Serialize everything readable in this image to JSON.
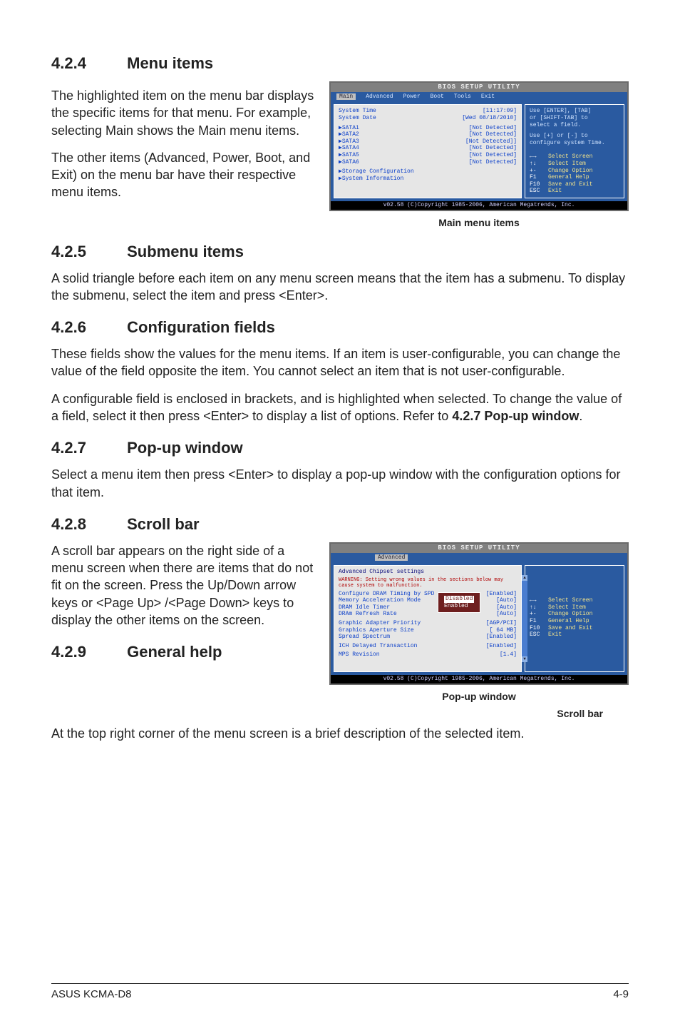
{
  "sections": {
    "s424": {
      "num": "4.2.4",
      "title": "Menu items"
    },
    "s425": {
      "num": "4.2.5",
      "title": "Submenu items"
    },
    "s426": {
      "num": "4.2.6",
      "title": "Configuration fields"
    },
    "s427": {
      "num": "4.2.7",
      "title": "Pop-up window"
    },
    "s428": {
      "num": "4.2.8",
      "title": "Scroll bar"
    },
    "s429": {
      "num": "4.2.9",
      "title": "General help"
    }
  },
  "para": {
    "p424a": "The highlighted item on the menu bar displays the specific items for that menu. For example, selecting Main shows the Main menu items.",
    "p424b": "The other items (Advanced, Power, Boot, and Exit) on the menu bar have their respective menu items.",
    "p425": "A solid triangle before each item on any menu screen means that the item has a submenu. To display the submenu, select the item and press <Enter>.",
    "p426a": "These fields show the values for the menu items. If an item is user-configurable, you can change the value of the field opposite the item. You cannot select an item that is not user-configurable.",
    "p426b_pre": "A configurable field is enclosed in brackets, and is highlighted when selected. To change the value of a field, select it then press <Enter> to display a list of options. Refer to ",
    "p426b_ref": "4.2.7 Pop-up window",
    "p426b_post": ".",
    "p427": "Select a menu item then press <Enter> to display a pop-up window with the configuration options for that item.",
    "p428": "A scroll bar appears on the right side of a menu screen when there are items that do not fit on the screen. Press the Up/Down arrow keys or <Page Up> /<Page Down> keys to display the other items on the screen.",
    "p429": "At the top right corner of the menu screen is a brief description of the selected item."
  },
  "captions": {
    "fig1": "Main menu items",
    "fig2a": "Pop-up window",
    "fig2b": "Scroll bar"
  },
  "bios1": {
    "title": "BIOS SETUP UTILITY",
    "menus": [
      "Main",
      "Advanced",
      "Power",
      "Boot",
      "Tools",
      "Exit"
    ],
    "active_menu": "Main",
    "items": [
      {
        "label": "System Time",
        "value": "[11:17:09]"
      },
      {
        "label": "System Date",
        "value": "[Wed 08/18/2010]"
      }
    ],
    "sata": [
      {
        "label": "SATA1",
        "value": "[Not Detected]"
      },
      {
        "label": "SATA2",
        "value": "[Not Detected]"
      },
      {
        "label": "SATA3",
        "value": "[Not Detected]]"
      },
      {
        "label": "SATA4",
        "value": "[Not Detected]"
      },
      {
        "label": "SATA5",
        "value": "[Not Detected]"
      },
      {
        "label": "SATA6",
        "value": "[Not Detected]"
      }
    ],
    "submenus": [
      "Storage Configuration",
      "System Information"
    ],
    "help": [
      "Use [ENTER], [TAB]",
      "or [SHIFT-TAB] to",
      "select a field.",
      "",
      "Use [+] or [-] to",
      "configure system Time."
    ],
    "keys": [
      {
        "k": "←→",
        "a": "Select Screen"
      },
      {
        "k": "↑↓",
        "a": "Select Item"
      },
      {
        "k": "+-",
        "a": "Change Option"
      },
      {
        "k": "F1",
        "a": "General Help"
      },
      {
        "k": "F10",
        "a": "Save and Exit"
      },
      {
        "k": "ESC",
        "a": "Exit"
      }
    ],
    "footer": "v02.58 (C)Copyright 1985-2006, American Megatrends, Inc."
  },
  "bios2": {
    "title": "BIOS SETUP UTILITY",
    "menus": [
      "Advanced"
    ],
    "subtitle": "Advanced Chipset settings",
    "warning": "WARNING: Setting wrong values in the sections below may cause system to malfunction.",
    "items": [
      {
        "label": "Configure DRAM Timing by SPD",
        "value": "[Enabled]"
      },
      {
        "label": "Memory Acceleration Mode",
        "value": "[Auto]"
      },
      {
        "label": "DRAM Idle Timer",
        "value": "[Auto]"
      },
      {
        "label": "DRAm Refresh Rate",
        "value": "[Auto]"
      },
      {
        "label": "Graphic Adapter Priority",
        "value": "[AGP/PCI]"
      },
      {
        "label": "Graphics Aperture Size",
        "value": "[ 64 MB]"
      },
      {
        "label": "Spread Spectrum",
        "value": "[Enabled]"
      },
      {
        "label": "ICH Delayed Transaction",
        "value": "[Enabled]"
      },
      {
        "label": "MPS Revision",
        "value": "[1.4]"
      }
    ],
    "popup_options": [
      "Disabled",
      "Enabled"
    ],
    "keys": [
      {
        "k": "←→",
        "a": "Select Screen"
      },
      {
        "k": "↑↓",
        "a": "Select Item"
      },
      {
        "k": "+-",
        "a": "Change Option"
      },
      {
        "k": "F1",
        "a": "General Help"
      },
      {
        "k": "F10",
        "a": "Save and Exit"
      },
      {
        "k": "ESC",
        "a": "Exit"
      }
    ],
    "footer": "v02.58 (C)Copyright 1985-2006, American Megatrends, Inc."
  },
  "footer": {
    "left": "ASUS KCMA-D8",
    "right": "4-9"
  }
}
